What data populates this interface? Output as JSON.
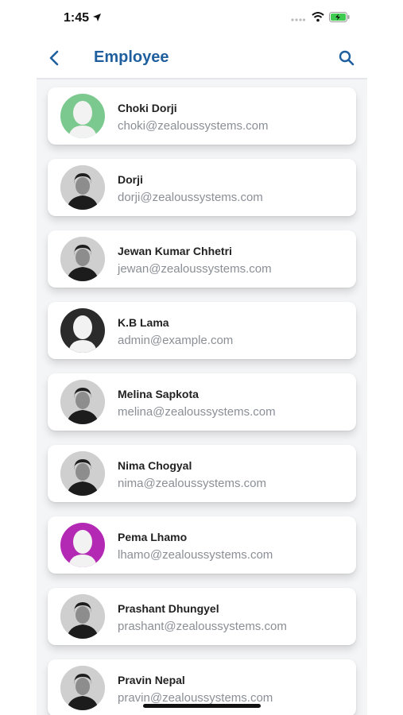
{
  "status_bar": {
    "time": "1:45"
  },
  "nav": {
    "title": "Employee"
  },
  "employees": [
    {
      "name": "Choki Dorji",
      "email": "choki@zealoussystems.com",
      "avatar": "placeholder",
      "avatar_color": "#7cc98f"
    },
    {
      "name": "Dorji",
      "email": "dorji@zealoussystems.com",
      "avatar": "photo"
    },
    {
      "name": "Jewan Kumar Chhetri",
      "email": "jewan@zealoussystems.com",
      "avatar": "photo"
    },
    {
      "name": "K.B Lama",
      "email": "admin@example.com",
      "avatar": "placeholder",
      "avatar_color": "#2b2b2b"
    },
    {
      "name": "Melina Sapkota",
      "email": "melina@zealoussystems.com",
      "avatar": "photo"
    },
    {
      "name": "Nima Chogyal",
      "email": "nima@zealoussystems.com",
      "avatar": "photo"
    },
    {
      "name": "Pema Lhamo",
      "email": "lhamo@zealoussystems.com",
      "avatar": "placeholder",
      "avatar_color": "#b429b4"
    },
    {
      "name": "Prashant Dhungyel",
      "email": "prashant@zealoussystems.com",
      "avatar": "photo"
    },
    {
      "name": "Pravin Nepal",
      "email": "pravin@zealoussystems.com",
      "avatar": "photo"
    }
  ],
  "colors": {
    "accent": "#1f5f9e",
    "background": "#f4f5f7"
  },
  "icons": {
    "back": "chevron-left-icon",
    "search": "search-icon"
  }
}
